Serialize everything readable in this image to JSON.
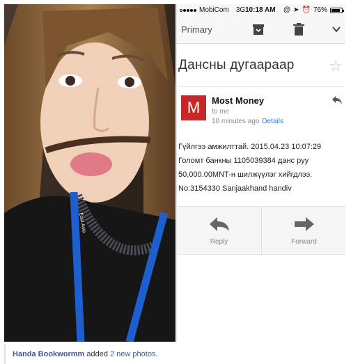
{
  "photo": {
    "badge_text": "East Asia"
  },
  "status_bar": {
    "carrier": "MobiCom",
    "network": "3G",
    "time": "10:18 AM",
    "battery": "76%"
  },
  "toolbar": {
    "back_label": "Primary"
  },
  "email": {
    "subject": "Дансны дугаараар",
    "avatar_letter": "M",
    "sender": "Most Money",
    "to": "to me",
    "time_ago": "10 minutes ago",
    "details_label": "Details",
    "body_lines": [
      "Гүйлгээ амжилттай. 2015.04.23 10:07:29",
      "Голомт банкны 1105039384 данс руу",
      "50,000.00MNT-н шилжүүлэг хийгдлээ.",
      "No:3154330 Sanjaakhand handiv"
    ],
    "reply_label": "Reply",
    "forward_label": "Forward"
  },
  "caption": {
    "author": "Handa Bookwormm",
    "action": " added ",
    "link": "2 new photos",
    "period": "."
  },
  "colors": {
    "avatar": "#c62828",
    "link": "#3b5998",
    "details": "#3a7bd5"
  }
}
